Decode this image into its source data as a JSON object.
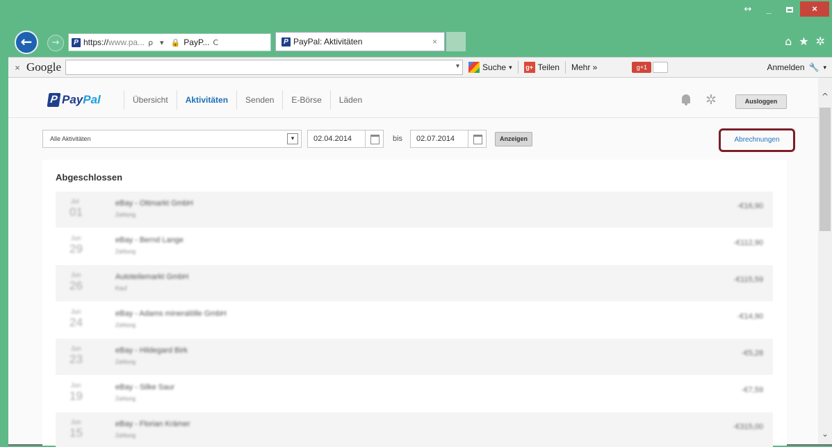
{
  "browser": {
    "window_controls": {
      "restore": "↔",
      "minimize": "_",
      "close": "×"
    },
    "address_bar": {
      "url_scheme": "https://",
      "url_host": "www.pa...",
      "search_glyph": "ρ",
      "dropdown_glyph": "▾",
      "site_label": "PayP...",
      "refresh_glyph": "C"
    },
    "tab": {
      "title": "PayPal: Aktivitäten",
      "close": "×"
    },
    "toolbar_icons": [
      "home-icon",
      "star-icon",
      "gear-icon"
    ],
    "icon_glyphs": {
      "back": "←",
      "forward": "→",
      "home": "⌂",
      "star": "★",
      "gear": "✲"
    }
  },
  "google_toolbar": {
    "close": "×",
    "logo": "Google",
    "dropdown_glyph": "▾",
    "search_label": "Suche",
    "share_icon_text": "g+",
    "share_label": "Teilen",
    "more_label": "Mehr »",
    "gplus_label": "g+1",
    "login_label": "Anmelden"
  },
  "paypal": {
    "logo": {
      "part1": "Pay",
      "part2": "Pal",
      "mark": "P"
    },
    "nav": [
      {
        "label": "Übersicht",
        "active": false
      },
      {
        "label": "Aktivitäten",
        "active": true
      },
      {
        "label": "Senden",
        "active": false
      },
      {
        "label": "E-Börse",
        "active": false
      },
      {
        "label": "Läden",
        "active": false
      }
    ],
    "logout_label": "Ausloggen",
    "gear_glyph": "✲",
    "filter": {
      "activity_select": "Alle Aktivitäten",
      "select_arrow": "▾",
      "date_from": "02.04.2014",
      "between": "bis",
      "date_to": "02.07.2014",
      "show_button": "Anzeigen"
    },
    "statements_link": "Abrechnungen",
    "section_title": "Abgeschlossen",
    "transactions": [
      {
        "day": "01",
        "month": "Jul",
        "name": "eBay - Ottmarkt GmbH",
        "type": "Zahlung",
        "amount": "-€16,90"
      },
      {
        "day": "29",
        "month": "Jun",
        "name": "eBay - Bernd Lange",
        "type": "Zahlung",
        "amount": "-€112,90"
      },
      {
        "day": "26",
        "month": "Jun",
        "name": "Autoteilemarkt GmbH",
        "type": "Kauf",
        "amount": "-€115,59"
      },
      {
        "day": "24",
        "month": "Jun",
        "name": "eBay - Adams mineralölle GmbH",
        "type": "Zahlung",
        "amount": "-€14,90"
      },
      {
        "day": "23",
        "month": "Jun",
        "name": "eBay - Hildegard Birk",
        "type": "Zahlung",
        "amount": "-€5,28"
      },
      {
        "day": "19",
        "month": "Jun",
        "name": "eBay - Silke Saur",
        "type": "Zahlung",
        "amount": "-€7,59"
      },
      {
        "day": "15",
        "month": "Jun",
        "name": "eBay - Florian Krämer",
        "type": "Zahlung",
        "amount": "-€315,00"
      }
    ]
  },
  "scrollbar": {
    "up_glyph": "^",
    "down_glyph": "⌄"
  }
}
